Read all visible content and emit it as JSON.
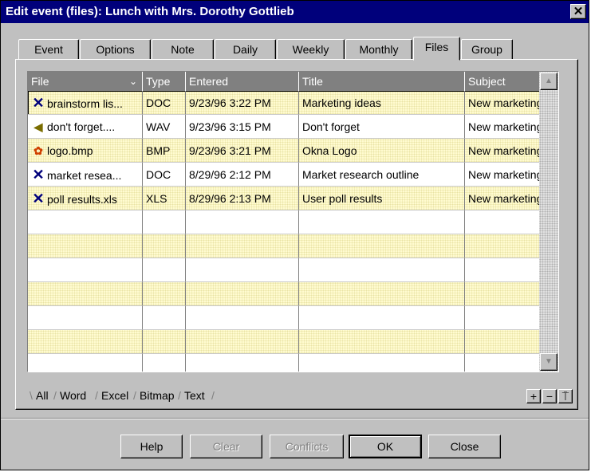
{
  "window": {
    "title": "Edit event (files): Lunch with Mrs. Dorothy Gottlieb",
    "close_glyph": "✕"
  },
  "tabs": [
    {
      "label": "Event"
    },
    {
      "label": "Options"
    },
    {
      "label": "Note"
    },
    {
      "label": "Daily"
    },
    {
      "label": "Weekly"
    },
    {
      "label": "Monthly"
    },
    {
      "label": "Files",
      "active": true
    },
    {
      "label": "Group"
    }
  ],
  "grid": {
    "columns": [
      "File",
      "Type",
      "Entered",
      "Title",
      "Subject"
    ],
    "sort_indicator": "⌄",
    "rows": [
      {
        "icon": "doc-icon",
        "glyph": "✕",
        "file": "brainstorm lis...",
        "type": "DOC",
        "entered": "9/23/96 3:22 PM",
        "title": "Marketing ideas",
        "subject": "New marketing."
      },
      {
        "icon": "sound-icon",
        "glyph": "◀",
        "file": "don't forget....",
        "type": "WAV",
        "entered": "9/23/96 3:15 PM",
        "title": "Don't forget",
        "subject": "New marketing."
      },
      {
        "icon": "bitmap-icon",
        "glyph": "✿",
        "file": "logo.bmp",
        "type": "BMP",
        "entered": "9/23/96 3:21 PM",
        "title": "Okna Logo",
        "subject": "New marketing."
      },
      {
        "icon": "doc-icon",
        "glyph": "✕",
        "file": "market resea...",
        "type": "DOC",
        "entered": "8/29/96 2:12 PM",
        "title": "Market research outline",
        "subject": "New marketing."
      },
      {
        "icon": "xls-icon",
        "glyph": "✕",
        "file": "poll results.xls",
        "type": "XLS",
        "entered": "8/29/96 2:13 PM",
        "title": "User poll results",
        "subject": "New marketing."
      }
    ],
    "scroll_up": "▲",
    "scroll_down": "▼"
  },
  "filter_tabs": [
    "All",
    "Word",
    "Excel",
    "Bitmap",
    "Text"
  ],
  "filter_controls": [
    "+",
    "−",
    "⍑"
  ],
  "buttons": {
    "help": "Help",
    "clear": "Clear",
    "conflicts": "Conflicts",
    "ok": "OK",
    "close": "Close"
  }
}
